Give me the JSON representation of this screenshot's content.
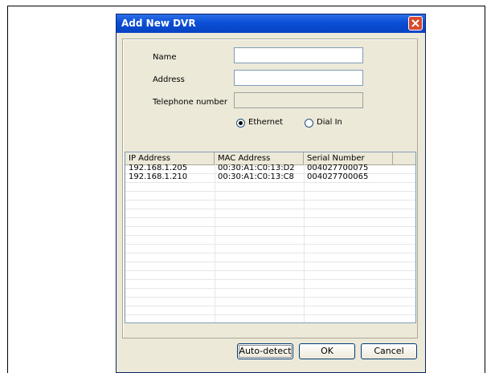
{
  "dialog": {
    "title": "Add New DVR"
  },
  "form": {
    "name_label": "Name",
    "address_label": "Address",
    "phone_label": "Telephone number",
    "name_value": "",
    "address_value": "",
    "phone_value": ""
  },
  "connection": {
    "ethernet_label": "Ethernet",
    "dialin_label": "Dial In",
    "selected": "Ethernet"
  },
  "table": {
    "columns": [
      "IP Address",
      "MAC Address",
      "Serial Number"
    ],
    "rows": [
      [
        "192.168.1.205",
        "00:30:A1:C0:13:D2",
        "004027700075"
      ],
      [
        "192.168.1.210",
        "00:30:A1:C0:13:C8",
        "004027700065"
      ]
    ]
  },
  "buttons": {
    "autodetect": "Auto-detect",
    "ok": "OK",
    "cancel": "Cancel"
  },
  "colors": {
    "titlebar": "#0a4fd6",
    "dialog_bg": "#ece9d8",
    "close": "#d9492c"
  }
}
